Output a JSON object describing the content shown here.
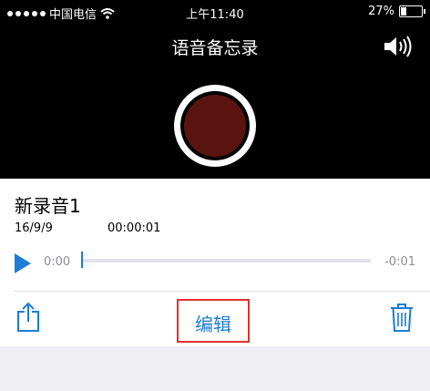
{
  "status": {
    "carrier": "中国电信",
    "time": "上午11:40",
    "battery": "27%",
    "battery_fraction": 0.27
  },
  "header": {
    "title": "语音备忘录"
  },
  "recording": {
    "name": "新录音1",
    "date": "16/9/9",
    "duration": "00:00:01",
    "time_start": "0:00",
    "time_end": "-0:01"
  },
  "toolbar": {
    "edit_label": "编辑"
  },
  "colors": {
    "accent": "#1c7cd6",
    "record": "#5a1410",
    "highlight": "#e03030"
  },
  "icons": [
    "signal-dots-icon",
    "wifi-icon",
    "battery-icon",
    "speaker-icon",
    "record-button",
    "play-icon",
    "share-icon",
    "trash-icon"
  ]
}
